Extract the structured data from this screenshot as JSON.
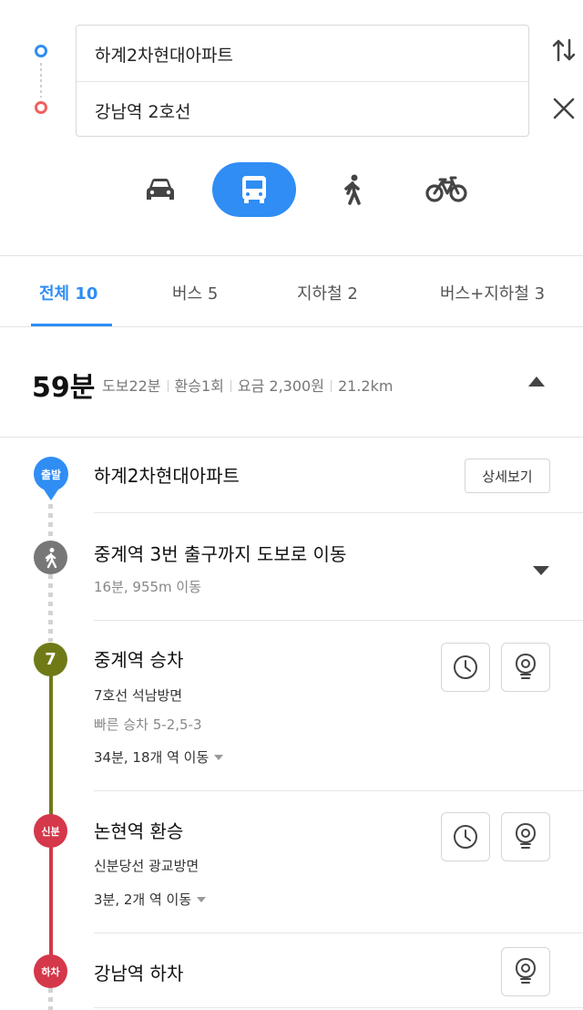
{
  "route": {
    "start": "하계2차현대아파트",
    "end": "강남역 2호선"
  },
  "modes": [
    "car-icon",
    "bus-icon",
    "walk-icon",
    "bike-icon"
  ],
  "active_mode": "bus",
  "colors": {
    "accent": "#2f8df4",
    "line7": "#6f7a17",
    "sinbundang": "#d4384a",
    "start_dot": "#2f8df4",
    "end_dot": "#f25f5c"
  },
  "tabs": [
    {
      "label": "전체 10",
      "active": true
    },
    {
      "label": "버스 5",
      "active": false
    },
    {
      "label": "지하철 2",
      "active": false
    },
    {
      "label": "버스+지하철 3",
      "active": false
    }
  ],
  "summary": {
    "time": "59분",
    "walk": "도보22분",
    "transfer": "환승1회",
    "fare": "요금 2,300원",
    "distance": "21.2km"
  },
  "steps": {
    "start": {
      "badge": "출발",
      "title": "하계2차현대아파트",
      "detail_button": "상세보기"
    },
    "walk": {
      "title": "중계역 3번 출구까지 도보로 이동",
      "sub": "16분, 955m 이동"
    },
    "board": {
      "badge": "7",
      "title": "중계역 승차",
      "direction": "7호선 석남방면",
      "fast": "빠른 승차 5-2,5-3",
      "duration": "34분, 18개 역 이동"
    },
    "transfer": {
      "badge": "신분",
      "title": "논현역 환승",
      "direction": "신분당선 광교방면",
      "duration": "3분, 2개 역 이동"
    },
    "alight": {
      "badge": "하차",
      "title": "강남역 하차"
    }
  }
}
